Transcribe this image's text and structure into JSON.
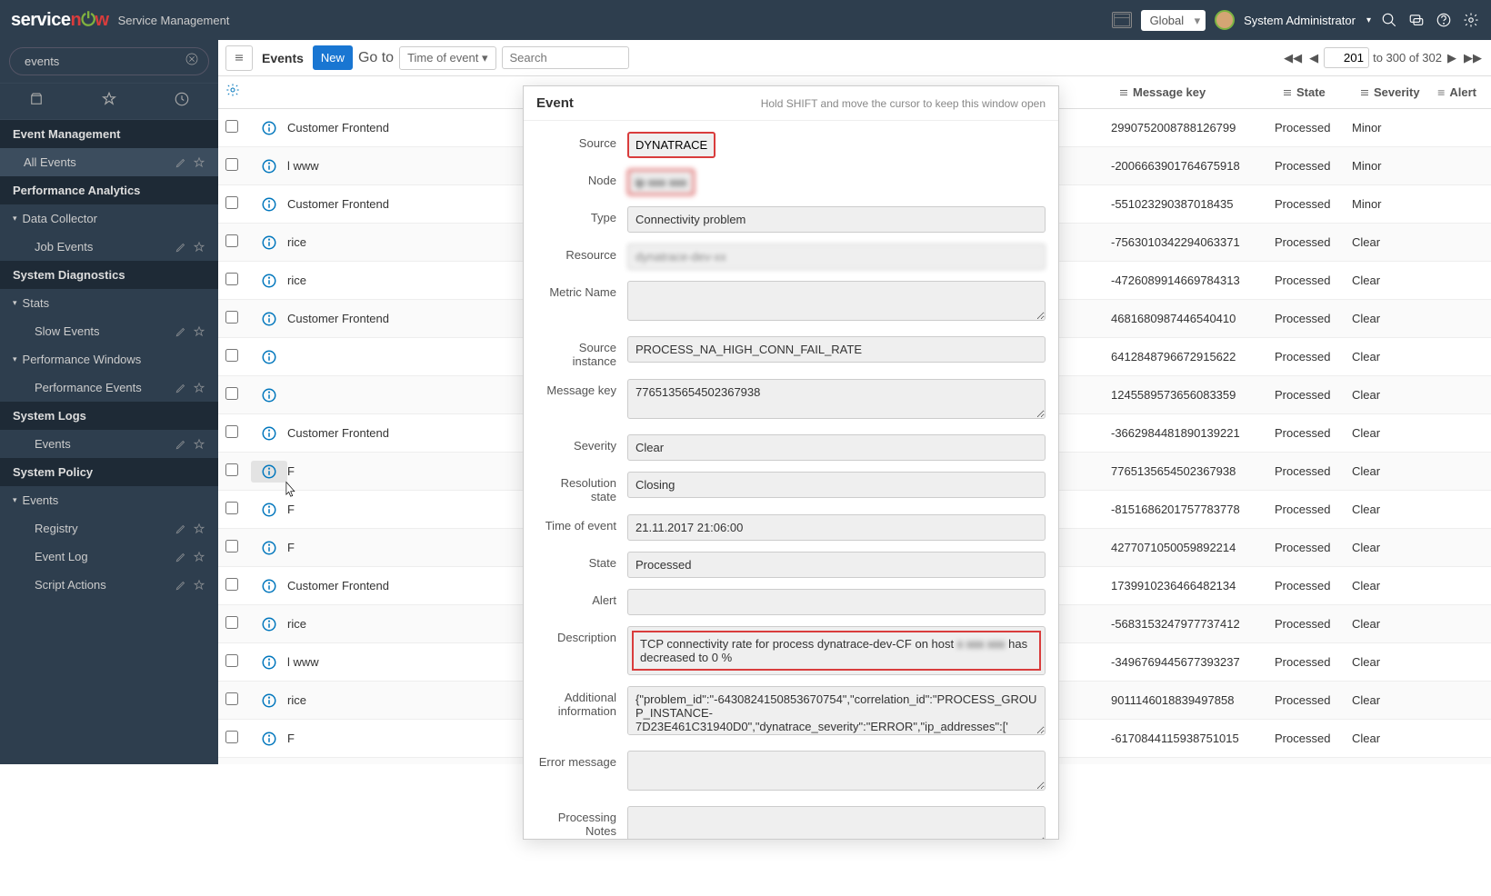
{
  "header": {
    "logo_service": "service",
    "logo_now": "n",
    "logo_ow": "w",
    "subtitle": "Service Management",
    "global": "Global",
    "user": "System Administrator"
  },
  "sidebar": {
    "search_value": "events",
    "sections": [
      {
        "type": "section",
        "label": "Event Management"
      },
      {
        "type": "item",
        "label": "All Events",
        "active": true,
        "actions": true
      },
      {
        "type": "section",
        "label": "Performance Analytics"
      },
      {
        "type": "item",
        "label": "Data Collector",
        "collapsible": true
      },
      {
        "type": "item",
        "label": "Job Events",
        "sub": true,
        "actions": true
      },
      {
        "type": "section",
        "label": "System Diagnostics"
      },
      {
        "type": "item",
        "label": "Stats",
        "collapsible": true
      },
      {
        "type": "item",
        "label": "Slow Events",
        "sub": true,
        "actions": true
      },
      {
        "type": "item",
        "label": "Performance Windows",
        "collapsible": true
      },
      {
        "type": "item",
        "label": "Performance Events",
        "sub": true,
        "actions": true
      },
      {
        "type": "section",
        "label": "System Logs"
      },
      {
        "type": "item",
        "label": "Events",
        "sub": true,
        "actions": true
      },
      {
        "type": "section",
        "label": "System Policy"
      },
      {
        "type": "item",
        "label": "Events",
        "collapsible": true
      },
      {
        "type": "item",
        "label": "Registry",
        "sub": true,
        "actions": true
      },
      {
        "type": "item",
        "label": "Event Log",
        "sub": true,
        "actions": true
      },
      {
        "type": "item",
        "label": "Script Actions",
        "sub": true,
        "actions": true
      }
    ]
  },
  "toolbar": {
    "title": "Events",
    "new": "New",
    "goto": "Go to",
    "sort_field": "Time of event ▾",
    "search_placeholder": "Search",
    "page_current": "201",
    "page_total": "to 300 of 302"
  },
  "columns": {
    "message_key": "Message key",
    "state": "State",
    "severity": "Severity",
    "alert": "Alert"
  },
  "rows": [
    {
      "node": "Customer Frontend",
      "key": "2990752008788126799",
      "state": "Processed",
      "sev": "Minor"
    },
    {
      "node": "l www",
      "key": "-2006663901764675918",
      "state": "Processed",
      "sev": "Minor"
    },
    {
      "node": "Customer Frontend",
      "key": "-551023290387018435",
      "state": "Processed",
      "sev": "Minor"
    },
    {
      "node": "rice",
      "key": "-7563010342294063371",
      "state": "Processed",
      "sev": "Clear"
    },
    {
      "node": "rice",
      "key": "-4726089914669784313",
      "state": "Processed",
      "sev": "Clear"
    },
    {
      "node": "Customer Frontend",
      "key": "4681680987446540410",
      "state": "Processed",
      "sev": "Clear"
    },
    {
      "node": "",
      "key": "6412848796672915622",
      "state": "Processed",
      "sev": "Clear"
    },
    {
      "node": "",
      "key": "1245589573656083359",
      "state": "Processed",
      "sev": "Clear"
    },
    {
      "node": "Customer Frontend",
      "key": "-3662984481890139221",
      "state": "Processed",
      "sev": "Clear"
    },
    {
      "node": "F",
      "key": "7765135654502367938",
      "state": "Processed",
      "sev": "Clear",
      "hover": true
    },
    {
      "node": "F",
      "key": "-8151686201757783778",
      "state": "Processed",
      "sev": "Clear"
    },
    {
      "node": "F",
      "key": "4277071050059892214",
      "state": "Processed",
      "sev": "Clear"
    },
    {
      "node": "Customer Frontend",
      "key": "1739910236466482134",
      "state": "Processed",
      "sev": "Clear"
    },
    {
      "node": "rice",
      "key": "-5683153247977737412",
      "state": "Processed",
      "sev": "Clear"
    },
    {
      "node": "l www",
      "key": "-3496769445677393237",
      "state": "Processed",
      "sev": "Clear"
    },
    {
      "node": "rice",
      "key": "9011146018839497858",
      "state": "Processed",
      "sev": "Clear"
    },
    {
      "node": "F",
      "key": "-6170844115938751015",
      "state": "Processed",
      "sev": "Clear"
    }
  ],
  "popup": {
    "title": "Event",
    "hint": "Hold SHIFT and move the cursor to keep this window open",
    "fields": {
      "source_label": "Source",
      "source": "DYNATRACE",
      "node_label": "Node",
      "node": "ip xxx xxx",
      "type_label": "Type",
      "type": "Connectivity problem",
      "resource_label": "Resource",
      "resource": "dynatrace-dev-xx",
      "metric_label": "Metric Name",
      "metric": "",
      "srcinst_label": "Source instance",
      "srcinst": "PROCESS_NA_HIGH_CONN_FAIL_RATE",
      "msgkey_label": "Message key",
      "msgkey": "7765135654502367938",
      "severity_label": "Severity",
      "severity": "Clear",
      "resstate_label": "Resolution state",
      "resstate": "Closing",
      "time_label": "Time of event",
      "time": "21.11.2017 21:06:00",
      "state_label": "State",
      "state": "Processed",
      "alert_label": "Alert",
      "alert": "",
      "desc_label": "Description",
      "desc_pre": "TCP connectivity rate for process dynatrace-dev-CF on host",
      "desc_blur": "x xxx xxx",
      "desc_post": "has decreased to 0 %",
      "addinfo_label": "Additional information",
      "addinfo": "{\"problem_id\":\"-6430824150853670754\",\"correlation_id\":\"PROCESS_GROUP_INSTANCE-7D23E461C31940D0\",\"dynatrace_severity\":\"ERROR\",\"ip_addresses\":[' xxxxx xxxx ')\"}]",
      "errmsg_label": "Error message",
      "errmsg": "",
      "procnotes_label": "Processing Notes",
      "procnotes": ""
    }
  }
}
